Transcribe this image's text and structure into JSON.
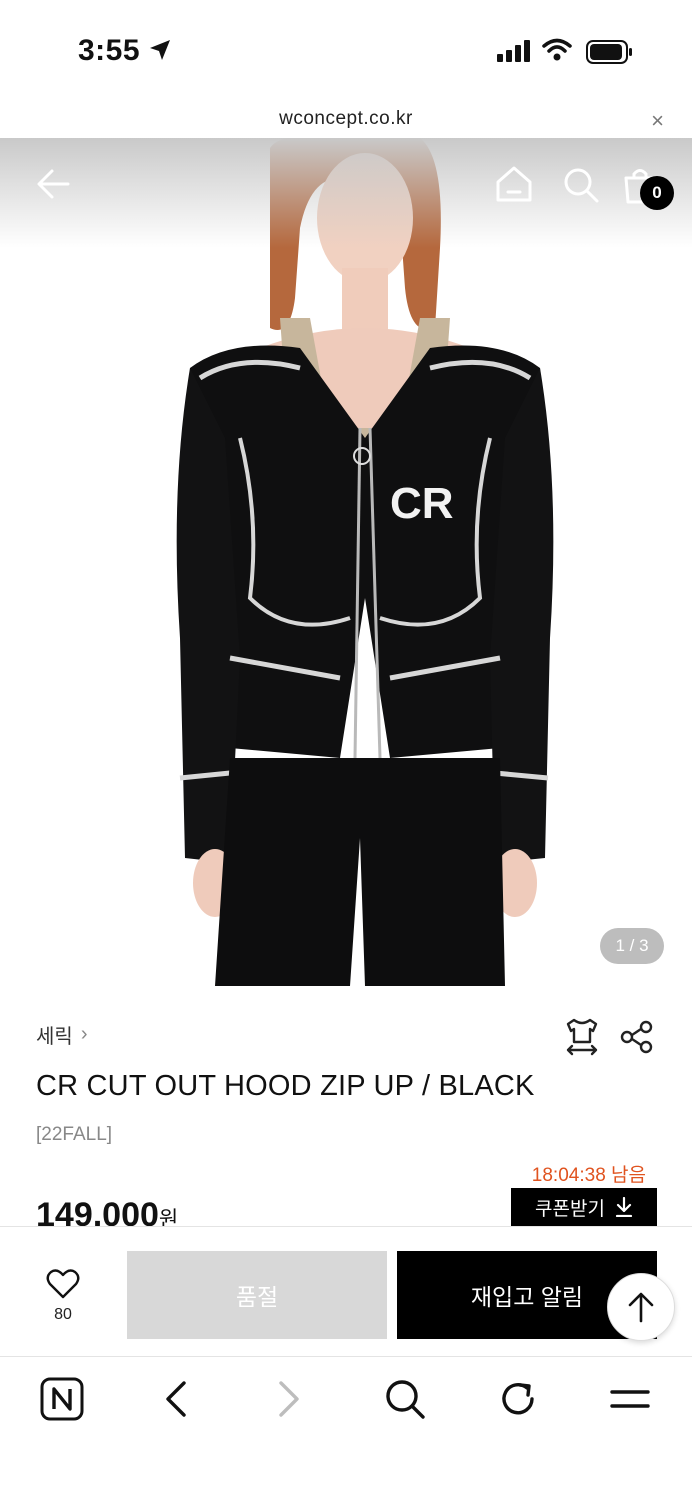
{
  "status_bar": {
    "time": "3:55"
  },
  "url_bar": {
    "domain": "wconcept.co.kr",
    "close_glyph": "×"
  },
  "header": {
    "cart_count": "0"
  },
  "gallery": {
    "counter": "1 / 3"
  },
  "product": {
    "brand": "세릭",
    "brand_chevron": "›",
    "title": "CR CUT OUT HOOD ZIP UP / BLACK",
    "season": "[22FALL]",
    "timer": "18:04:38 남음",
    "price": "149,000",
    "price_unit": "원",
    "coupon_label": "쿠폰받기"
  },
  "actions": {
    "like_count": "80",
    "soldout_label": "품절",
    "restock_label": "재입고 알림"
  },
  "colors": {
    "accent_timer": "#e0531f",
    "primary_button": "#000000",
    "disabled_button": "#d8d8d8"
  },
  "icons": [
    "location-arrow-icon",
    "signal-icon",
    "wifi-icon",
    "battery-icon",
    "back-arrow-icon",
    "home-icon",
    "search-icon",
    "cart-icon",
    "hanger-size-icon",
    "share-icon",
    "heart-icon",
    "arrow-up-icon",
    "naver-n-icon",
    "browser-back-icon",
    "browser-forward-icon",
    "browser-search-icon",
    "refresh-icon",
    "menu-icon"
  ]
}
